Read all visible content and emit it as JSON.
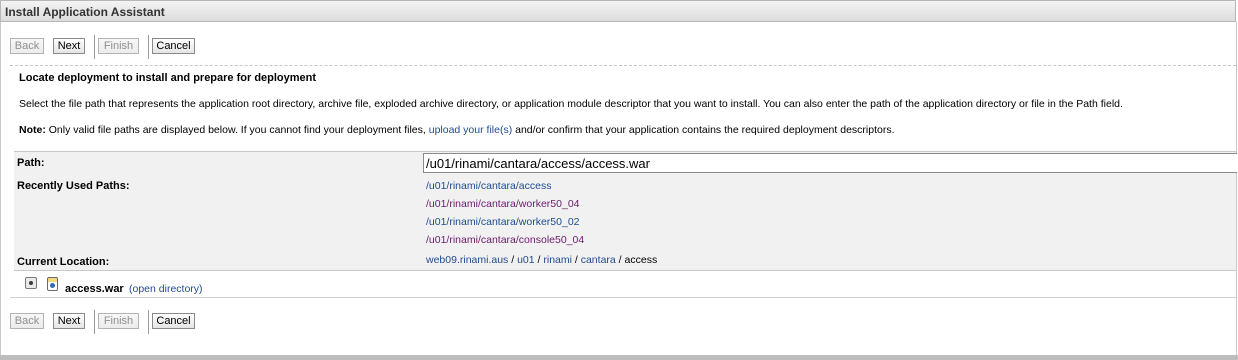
{
  "window": {
    "title": "Install Application Assistant"
  },
  "buttons": {
    "back": "Back",
    "next": "Next",
    "finish": "Finish",
    "cancel": "Cancel"
  },
  "content": {
    "heading": "Locate deployment to install and prepare for deployment",
    "description": "Select the file path that represents the application root directory, archive file, exploded archive directory, or application module descriptor that you want to install. You can also enter the path of the application directory or file in the Path field.",
    "note_label": "Note:",
    "note_before": " Only valid file paths are displayed below. If you cannot find your deployment files, ",
    "note_link": "upload your file(s)",
    "note_after": " and/or confirm that your application contains the required deployment descriptors."
  },
  "form": {
    "path_label": "Path:",
    "path_value": "/u01/rinami/cantara/access/access.war",
    "recent_label": "Recently Used Paths:",
    "recent_paths": [
      "/u01/rinami/cantara/access",
      "/u01/rinami/cantara/worker50_04",
      "/u01/rinami/cantara/worker50_02",
      "/u01/rinami/cantara/console50_04"
    ],
    "current_location_label": "Current Location:",
    "breadcrumb": [
      "web09.rinami.aus",
      "u01",
      "rinami",
      "cantara"
    ],
    "breadcrumb_sep": " / ",
    "breadcrumb_current": "access"
  },
  "files": [
    {
      "name": "access.war",
      "action": "(open directory)",
      "icon": "archive-file-icon",
      "selected": true
    }
  ],
  "colors": {
    "link": "#1f4b8f",
    "visited_link": "#6a1b6a",
    "panel_bg": "#f1f1f1"
  }
}
